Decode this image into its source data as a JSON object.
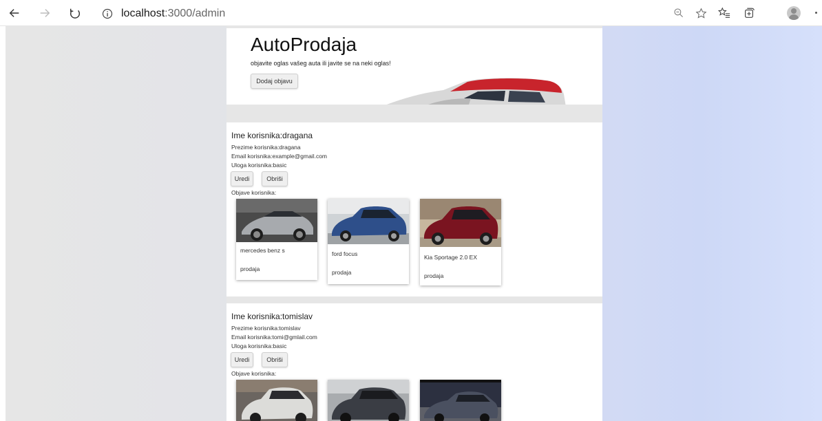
{
  "browser": {
    "url_host": "localhost",
    "url_path": ":3000/admin"
  },
  "hero": {
    "title": "AutoProdaja",
    "subtitle": "objavite oglas vašeg auta ili javite se na neki oglas!",
    "add_button": "Dodaj objavu"
  },
  "users": [
    {
      "name": "Ime korisnika:dragana",
      "surname": "Prezime korisnika:dragana",
      "email": "Email korisnika:example@gmail.com",
      "role": "Uloga korisnika:basic",
      "edit_label": "Uredi",
      "delete_label": "Obriši",
      "posts_label": "Objave korisnika:",
      "posts": [
        {
          "title": "mercedes benz s",
          "type": "prodaja",
          "color": "#8c8f94"
        },
        {
          "title": "ford focus",
          "type": "prodaja",
          "color": "#2e4f8a"
        },
        {
          "title": "Kia Sportage 2.0 EX",
          "type": "prodaja",
          "color": "#7a1420"
        }
      ]
    },
    {
      "name": "Ime korisnika:tomislav",
      "surname": "Prezime korisnika:tomislav",
      "email": "Email korisnika:tomi@gmlail.com",
      "role": "Uloga korisnika:basic",
      "edit_label": "Uredi",
      "delete_label": "Obriši",
      "posts_label": "Objave korisnika:",
      "posts": [
        {
          "color": "#d8d8d6"
        },
        {
          "color": "#3a3d44"
        },
        {
          "color": "#4a5060"
        }
      ]
    }
  ]
}
